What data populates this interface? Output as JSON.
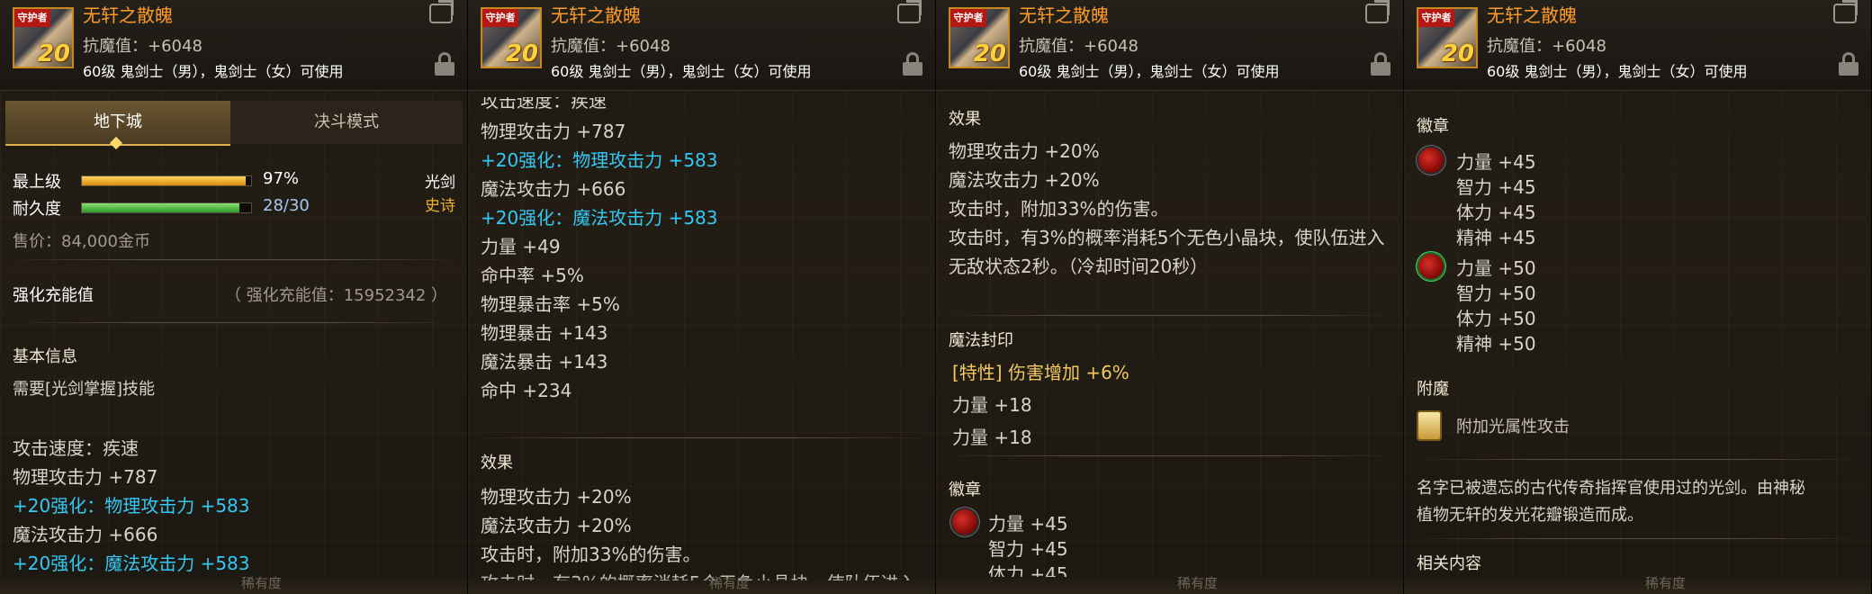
{
  "item": {
    "icon_tag": "守护者",
    "icon_level": "20",
    "name": "无轩之散魄",
    "resist": "抗魔值：+6048",
    "classes": "60级 鬼剑士（男），鬼剑士（女）可使用"
  },
  "tabs": [
    "地下城",
    "决斗模式"
  ],
  "stats": {
    "grade_label": "最上级",
    "grade_value": "97%",
    "grade_fill": 0.97,
    "durability_label": "耐久度",
    "durability_value": "28/30",
    "durability_fill": 0.9333,
    "weapon_type": "光剑",
    "rarity": "史诗",
    "price": "售价：84,000金币"
  },
  "enhance": {
    "label": "强化充能值",
    "value": "（ 强化充能值：15952342 ）"
  },
  "basic": {
    "title": "基本信息",
    "req": "需要[光剑掌握]技能"
  },
  "attrs": [
    {
      "text": "攻击速度：疾速",
      "color": "normal"
    },
    {
      "text": "物理攻击力 +787",
      "color": "normal"
    },
    {
      "text": "+20强化：物理攻击力 +583",
      "color": "blue"
    },
    {
      "text": "魔法攻击力 +666",
      "color": "normal"
    },
    {
      "text": "+20强化：魔法攻击力 +583",
      "color": "blue"
    },
    {
      "text": "力量 +49",
      "color": "normal"
    },
    {
      "text": "命中率 +5%",
      "color": "normal"
    },
    {
      "text": "物理暴击率 +5%",
      "color": "normal"
    },
    {
      "text": "物理暴击 +143",
      "color": "normal"
    },
    {
      "text": "魔法暴击 +143",
      "color": "normal"
    },
    {
      "text": "命中 +234",
      "color": "normal"
    }
  ],
  "effect": {
    "title": "效果",
    "lines": [
      "物理攻击力 +20%",
      "魔法攻击力 +20%",
      "攻击时，附加33%的伤害。",
      "攻击时，有3%的概率消耗5个无色小晶块，使队伍进入",
      "无敌状态2秒。（冷却时间20秒）"
    ],
    "line4_partial": "攻击时，有3%的概率消耗5个无色小晶块，使队伍进入"
  },
  "seal": {
    "title": "魔法封印",
    "trait": "[特性] 伤害增加 +6%",
    "lines": [
      "力量 +18",
      "力量 +18"
    ]
  },
  "emblem": {
    "title": "徽章",
    "slot1": [
      "力量 +45",
      "智力 +45",
      "体力 +45",
      "精神 +45"
    ],
    "slot2": [
      "力量 +50",
      "智力 +50",
      "体力 +50",
      "精神 +50"
    ]
  },
  "enchant": {
    "title": "附魔",
    "text": "附加光属性攻击"
  },
  "desc": {
    "line1": "名字已被遗忘的古代传奇指挥官使用过的光剑。由神秘",
    "line2": "植物无轩的发光花瓣锻造而成。"
  },
  "related": {
    "title": "相关内容"
  },
  "ghost": {
    "text": "稀有度"
  },
  "colors": {
    "name": "#ff9a2a",
    "enhance_blue": "#35c8f2",
    "trait_gold": "#f3c863",
    "grade_bar": "#f0b030",
    "durability_bar": "#40c040"
  }
}
